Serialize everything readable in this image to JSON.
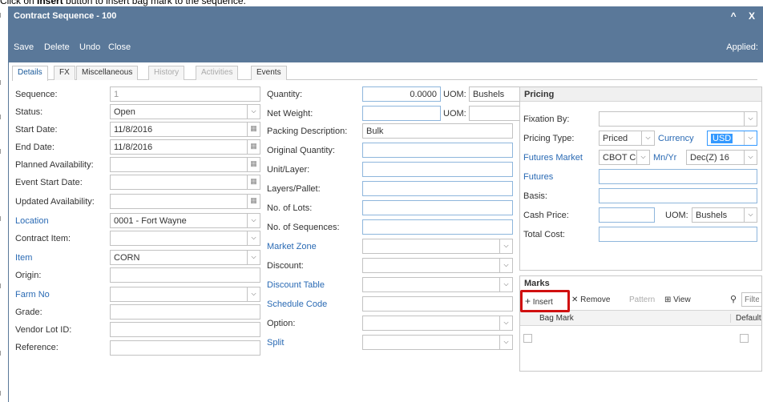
{
  "caption": {
    "prefix": "Click on ",
    "bold": "Insert",
    "suffix": " button to insert bag mark to the sequence."
  },
  "window": {
    "title": "Contract Sequence - 100",
    "controls": "^ X"
  },
  "toolbar": {
    "save": "Save",
    "delete": "Delete",
    "undo": "Undo",
    "close": "Close",
    "applied": "Applied:"
  },
  "tabs": [
    {
      "label": "Details",
      "active": true
    },
    {
      "label": "FX"
    },
    {
      "label": "Miscellaneous"
    },
    {
      "label": "History",
      "disabled": true
    },
    {
      "label": "Activities",
      "disabled": true
    },
    {
      "label": "Events"
    }
  ],
  "left": {
    "sequence": {
      "label": "Sequence:",
      "value": "1"
    },
    "status": {
      "label": "Status:",
      "value": "Open"
    },
    "start_date": {
      "label": "Start Date:",
      "value": "11/8/2016"
    },
    "end_date": {
      "label": "End Date:",
      "value": "11/8/2016"
    },
    "planned": {
      "label": "Planned Availability:",
      "value": ""
    },
    "event_start": {
      "label": "Event Start Date:",
      "value": ""
    },
    "updated": {
      "label": "Updated Availability:",
      "value": ""
    },
    "location": {
      "label": "Location",
      "value": "0001 - Fort Wayne"
    },
    "contract_item": {
      "label": "Contract Item:",
      "value": ""
    },
    "item": {
      "label": "Item",
      "value": "CORN"
    },
    "origin": {
      "label": "Origin:",
      "value": ""
    },
    "farm_no": {
      "label": "Farm No",
      "value": ""
    },
    "grade": {
      "label": "Grade:",
      "value": ""
    },
    "vendor_lot": {
      "label": "Vendor Lot ID:",
      "value": ""
    },
    "reference": {
      "label": "Reference:",
      "value": ""
    }
  },
  "middle": {
    "quantity": {
      "label": "Quantity:",
      "value": "0.0000",
      "uom_label": "UOM:",
      "uom": "Bushels"
    },
    "net_weight": {
      "label": "Net Weight:",
      "value": "",
      "uom_label": "UOM:",
      "uom": ""
    },
    "packing": {
      "label": "Packing Description:",
      "value": "Bulk"
    },
    "original_qty": {
      "label": "Original Quantity:",
      "value": ""
    },
    "unit_layer": {
      "label": "Unit/Layer:",
      "value": ""
    },
    "layers_pallet": {
      "label": "Layers/Pallet:",
      "value": ""
    },
    "no_lots": {
      "label": "No. of Lots:",
      "value": ""
    },
    "no_sequences": {
      "label": "No. of Sequences:",
      "value": ""
    },
    "market_zone": {
      "label": "Market Zone",
      "value": ""
    },
    "discount": {
      "label": "Discount:",
      "value": ""
    },
    "discount_table": {
      "label": "Discount Table",
      "value": ""
    },
    "schedule_code": {
      "label": "Schedule Code",
      "value": ""
    },
    "option": {
      "label": "Option:",
      "value": ""
    },
    "split": {
      "label": "Split",
      "value": ""
    }
  },
  "pricing": {
    "header": "Pricing",
    "fixation_by": {
      "label": "Fixation By:",
      "value": ""
    },
    "pricing_type": {
      "label": "Pricing Type:",
      "value": "Priced"
    },
    "currency": {
      "label": "Currency",
      "value": "USD"
    },
    "futures_market": {
      "label": "Futures Market",
      "value": "CBOT Co"
    },
    "mn_yr": {
      "label": "Mn/Yr",
      "value": "Dec(Z) 16"
    },
    "futures": {
      "label": "Futures",
      "value": ""
    },
    "basis": {
      "label": "Basis:",
      "value": ""
    },
    "cash_price": {
      "label": "Cash Price:",
      "value": "",
      "uom_label": "UOM:",
      "uom": "Bushels"
    },
    "total_cost": {
      "label": "Total Cost:",
      "value": ""
    }
  },
  "marks": {
    "header": "Marks",
    "insert": "Insert",
    "remove": "Remove",
    "pattern": "Pattern",
    "view": "View",
    "filter_placeholder": "Filter",
    "columns": [
      "Bag Mark",
      "Default"
    ]
  },
  "colors": {
    "titlebar": "#5a7899",
    "link": "#2a6ab4",
    "highlight": "#d01010",
    "selection": "#3399ff"
  }
}
